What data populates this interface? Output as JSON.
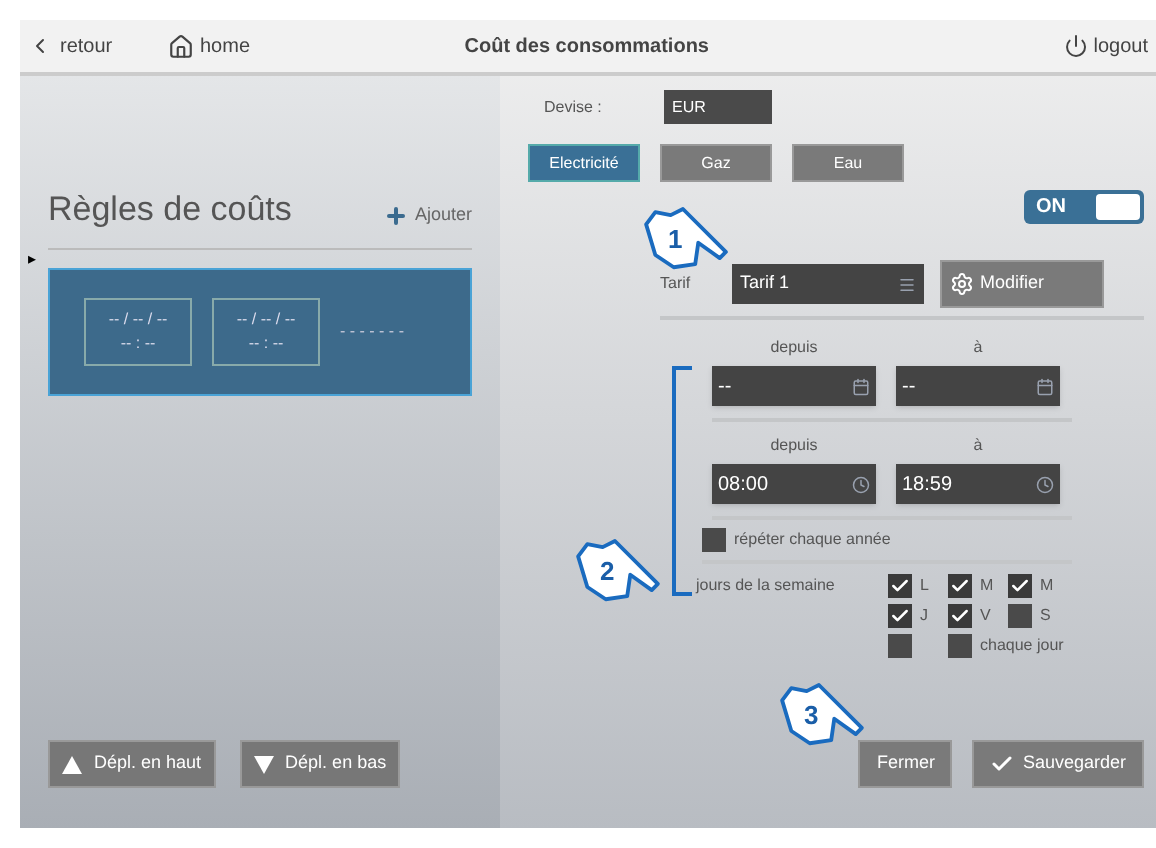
{
  "header": {
    "back": "retour",
    "home": "home",
    "title": "Coût des consommations",
    "logout": "logout"
  },
  "rules": {
    "title": "Règles de coûts",
    "add": "Ajouter",
    "marker": "▸",
    "items": [
      {
        "selected": true,
        "date_from": "-- / -- / --",
        "time_from": "-- : --",
        "date_to": "-- / -- / --",
        "time_to": "-- : --",
        "more": "- - - - - - -"
      }
    ]
  },
  "move_buttons": [
    {
      "kind": "up",
      "label": "Dépl. en haut"
    },
    {
      "kind": "down",
      "label": "Dépl. en bas"
    }
  ],
  "currency": {
    "label": "Devise :",
    "value": "EUR"
  },
  "energy_tabs": [
    {
      "label": "Electricité",
      "selected": true
    },
    {
      "label": "Gaz",
      "selected": false
    },
    {
      "label": "Eau",
      "selected": false
    }
  ],
  "toggle": {
    "label": "ON",
    "on": true
  },
  "tariff": {
    "label": "Tarif",
    "value": "Tarif 1",
    "button": "Modifier"
  },
  "date_range": {
    "from_label": "depuis",
    "to_label": "à",
    "from": "--",
    "to": "--"
  },
  "time_range": {
    "from_label": "depuis",
    "to_label": "à",
    "from": "08:00",
    "to": "18:59"
  },
  "repeat": {
    "label": "répéter chaque année",
    "checked": false
  },
  "weekdays": {
    "label": "jours de la semaine",
    "days": [
      {
        "label": "L",
        "checked": true
      },
      {
        "label": "M",
        "checked": true
      },
      {
        "label": "M",
        "checked": true
      },
      {
        "label": "J",
        "checked": true
      },
      {
        "label": "V",
        "checked": true
      },
      {
        "label": "S",
        "checked": false
      },
      {
        "checked": false
      },
      {
        "label": "chaque jour",
        "checked": false
      }
    ]
  },
  "actions": [
    {
      "kind": "close",
      "label": "Fermer"
    },
    {
      "kind": "save",
      "label": "Sauvegarder"
    }
  ],
  "callouts": [
    "1",
    "2",
    "3"
  ]
}
